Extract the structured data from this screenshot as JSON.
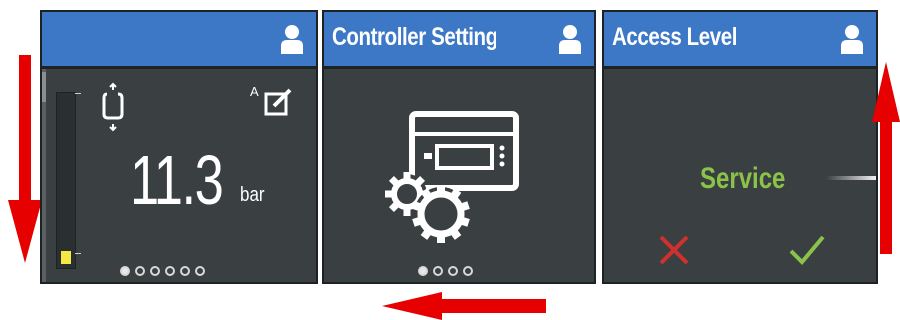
{
  "screens": [
    {
      "header_title": "",
      "value": "11.3",
      "unit": "bar",
      "mode_label": "A",
      "fill_level": 0.08,
      "page_count": 6,
      "active_page": 1
    },
    {
      "header_title": "Controller Setting",
      "page_count": 4,
      "active_page": 1
    },
    {
      "header_title": "Access Level",
      "status_text": "Service"
    }
  ],
  "icons": {
    "user": "user-icon",
    "switch_mode": "switch-mode-icon",
    "edit": "edit-icon",
    "controller_settings": "controller-gear-icon",
    "cancel": "cancel-x-icon",
    "confirm": "confirm-check-icon"
  },
  "colors": {
    "header": "#3d78c7",
    "screen_bg": "#3a3f41",
    "level_fill": "#f5e942",
    "service_text": "#8bc34a",
    "cancel": "#d32f2f",
    "confirm": "#8bc34a",
    "swipe_arrow": "#e60000"
  },
  "swipe_arrows": [
    "down",
    "left",
    "up"
  ]
}
